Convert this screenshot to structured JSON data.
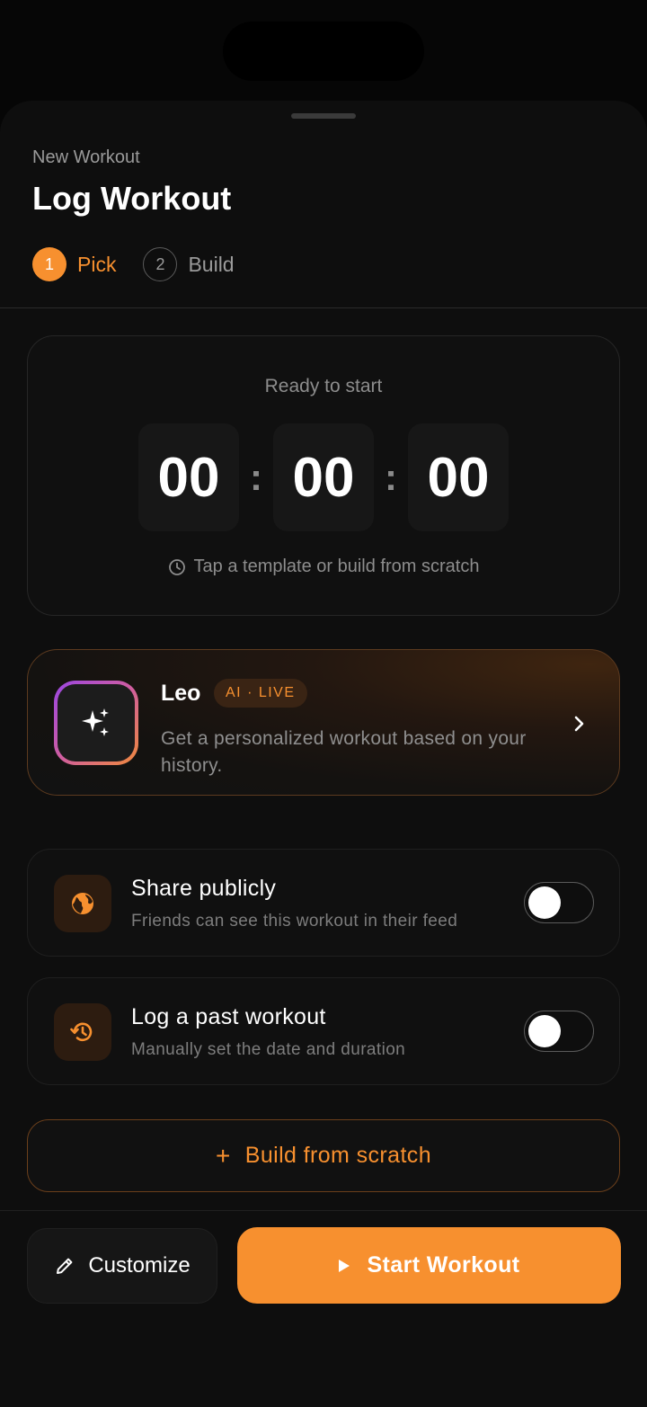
{
  "header": {
    "subtitle": "New Workout",
    "title": "Log Workout"
  },
  "steps": [
    {
      "number": "1",
      "label": "Pick",
      "active": true
    },
    {
      "number": "2",
      "label": "Build",
      "active": false
    }
  ],
  "timer": {
    "status": "Ready to start",
    "hours": "00",
    "minutes": "00",
    "seconds": "00",
    "separator": ":",
    "hint": "Tap a template or build from scratch",
    "hint_icon": "clock-icon"
  },
  "leo": {
    "name": "Leo",
    "badge": "AI · LIVE",
    "description": "Get a personalized workout based on your history.",
    "icon": "sparkles-icon"
  },
  "options": {
    "share": {
      "title": "Share publicly",
      "subtitle": "Friends can see this workout in their feed",
      "icon": "globe-icon",
      "enabled": false
    },
    "past": {
      "title": "Log a past workout",
      "subtitle": "Manually set the date and duration",
      "icon": "history-icon",
      "enabled": false
    }
  },
  "actions": {
    "build_label": "Build from scratch",
    "build_icon": "+",
    "customize_label": "Customize",
    "start_label": "Start Workout"
  },
  "colors": {
    "accent": "#f7902f",
    "background": "#0e0e0e"
  }
}
